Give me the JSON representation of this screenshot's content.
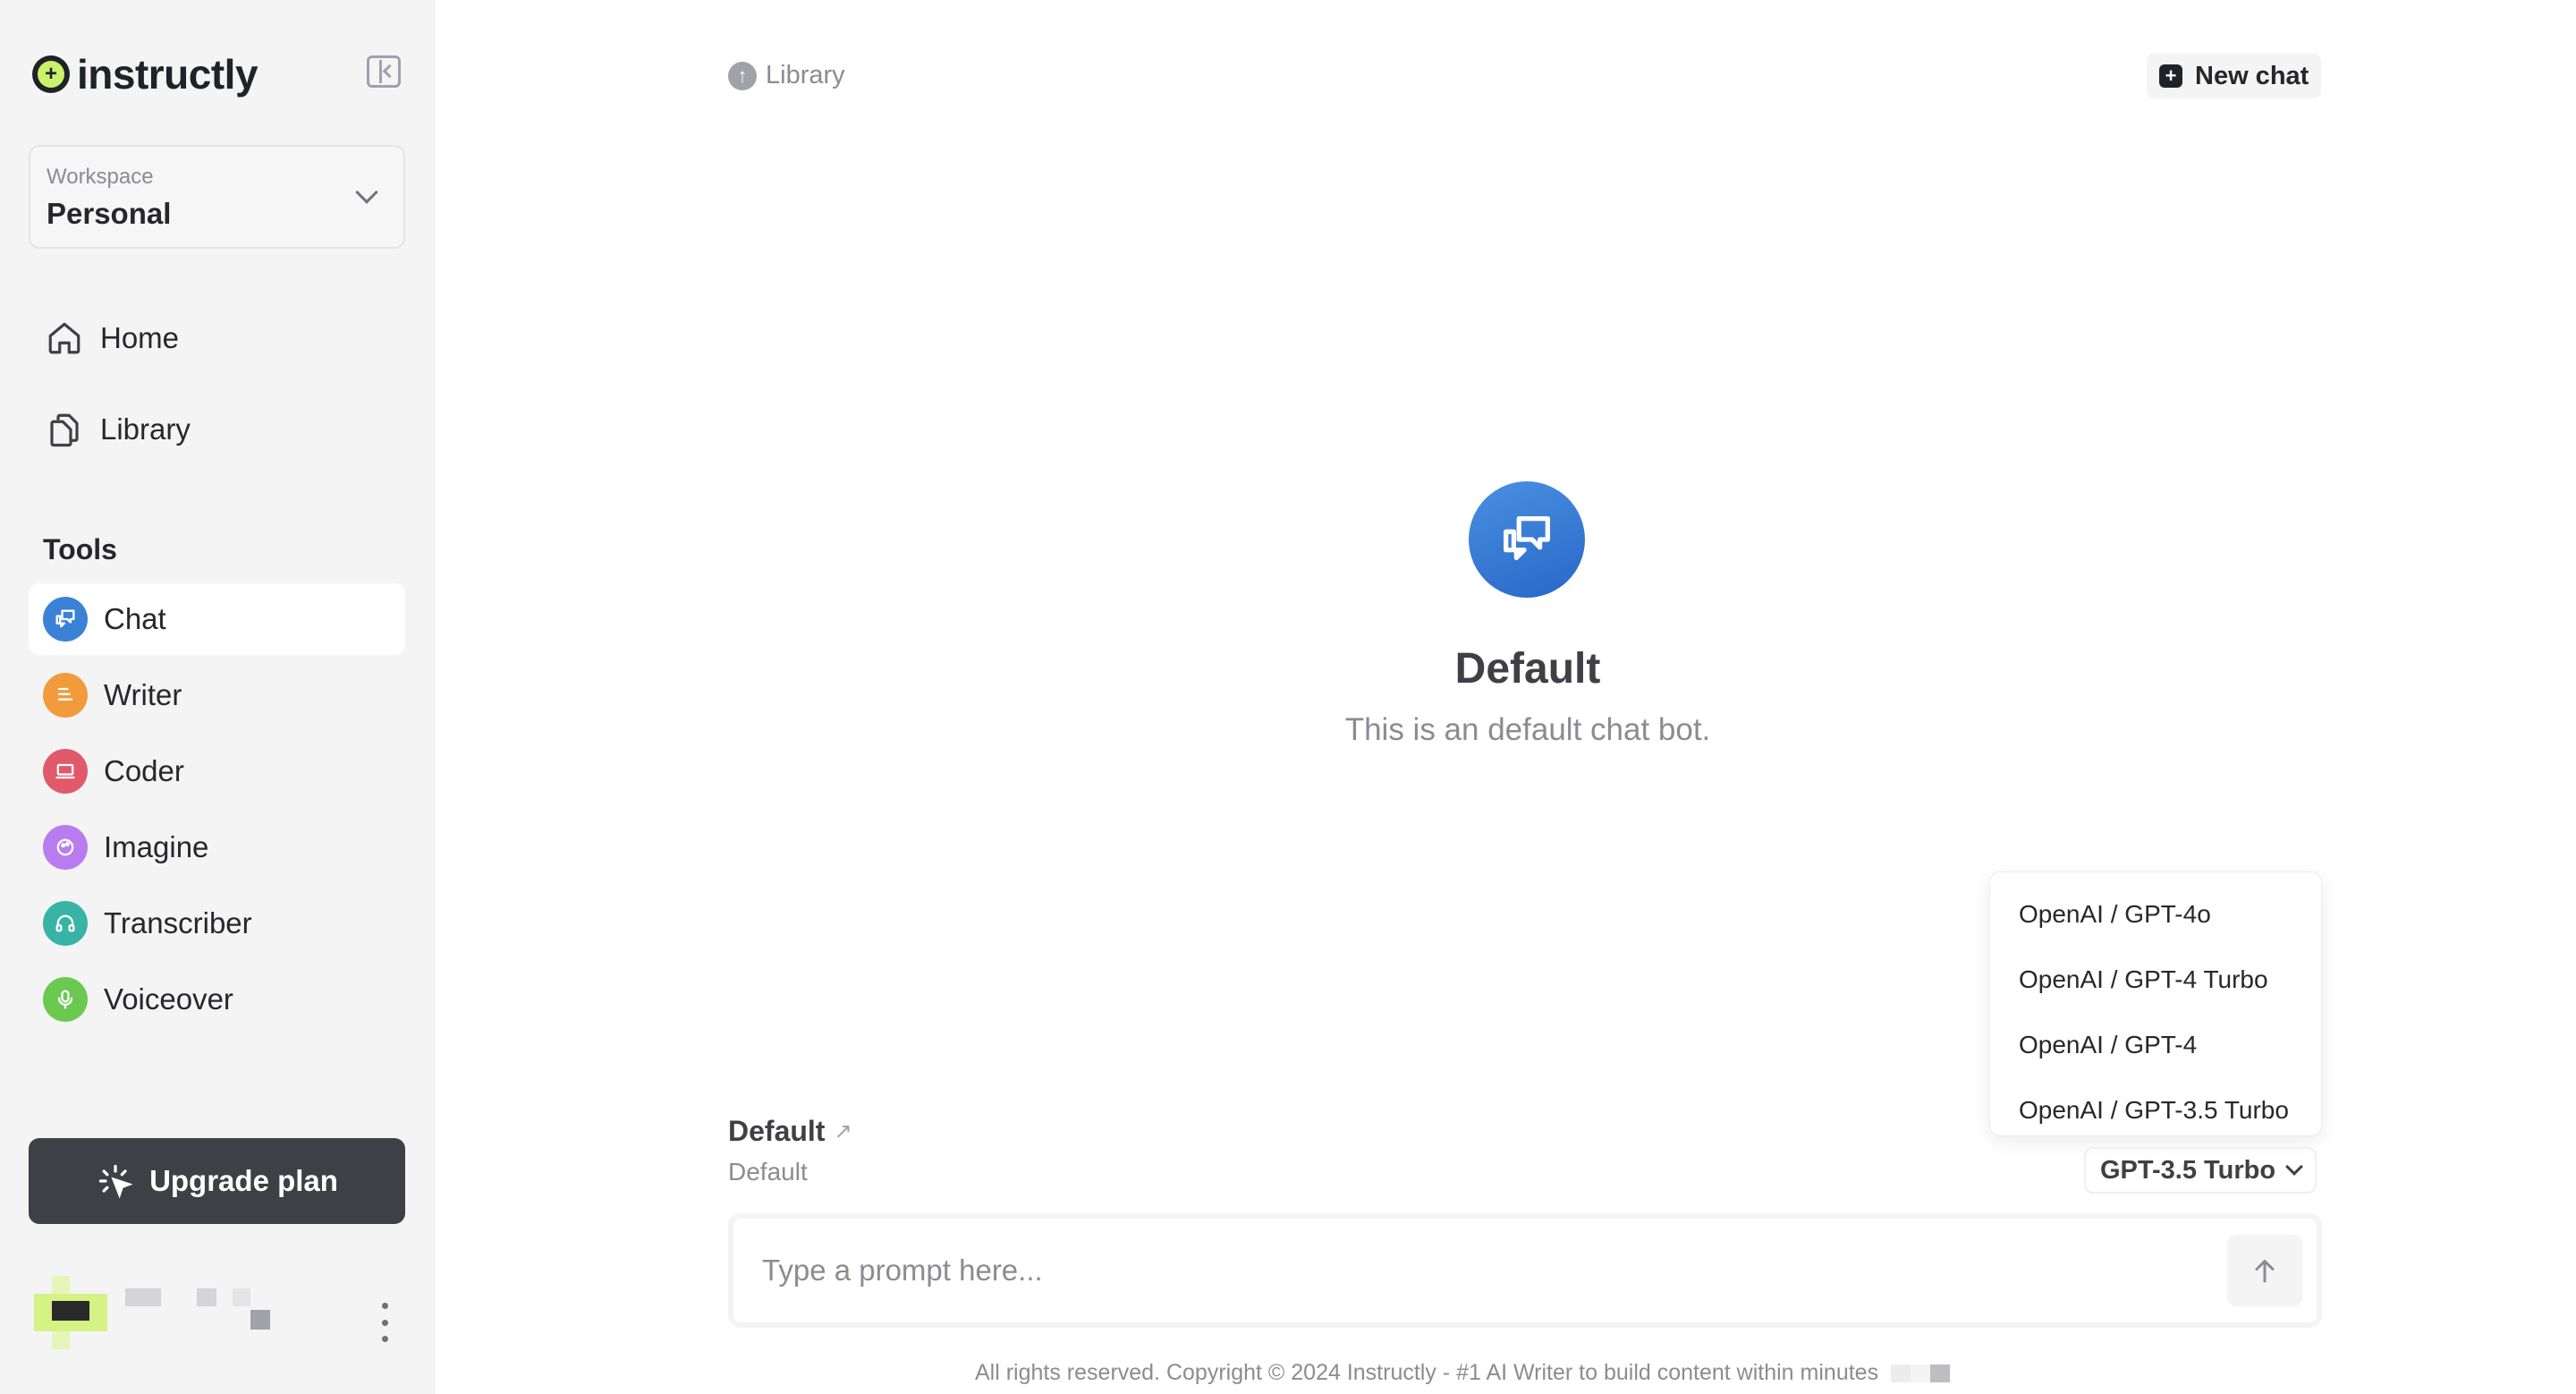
{
  "brand": {
    "name": "instructly"
  },
  "workspace": {
    "label": "Workspace",
    "value": "Personal"
  },
  "nav": [
    {
      "label": "Home",
      "icon": "home-icon"
    },
    {
      "label": "Library",
      "icon": "library-icon"
    }
  ],
  "tools": {
    "title": "Tools",
    "items": [
      {
        "label": "Chat",
        "icon": "chat-icon",
        "color": "#3b82d6"
      },
      {
        "label": "Writer",
        "icon": "writer-icon",
        "color": "#f29b3c"
      },
      {
        "label": "Coder",
        "icon": "coder-icon",
        "color": "#e05a6a"
      },
      {
        "label": "Imagine",
        "icon": "imagine-icon",
        "color": "#b97cf0"
      },
      {
        "label": "Transcriber",
        "icon": "transcriber-icon",
        "color": "#39b3a6"
      },
      {
        "label": "Voiceover",
        "icon": "voiceover-icon",
        "color": "#6cc94f"
      }
    ]
  },
  "upgrade": {
    "label": "Upgrade plan"
  },
  "header": {
    "breadcrumb": "Library",
    "new_chat": "New chat"
  },
  "bot": {
    "name": "Default",
    "description": "This is an default chat bot."
  },
  "model_menu": {
    "options": [
      "OpenAI / GPT-4o",
      "OpenAI / GPT-4 Turbo",
      "OpenAI / GPT-4",
      "OpenAI / GPT-3.5 Turbo"
    ],
    "selected": "GPT-3.5 Turbo"
  },
  "chat": {
    "title": "Default",
    "subtitle": "Default"
  },
  "prompt": {
    "placeholder": "Type a prompt here..."
  },
  "footer": {
    "text": "All rights reserved. Copyright © 2024 Instructly - #1 AI Writer to build content within minutes"
  }
}
